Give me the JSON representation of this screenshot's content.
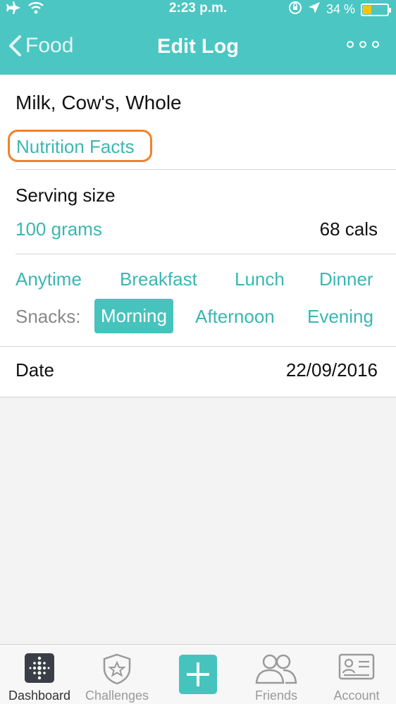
{
  "status_bar": {
    "time": "2:23 p.m.",
    "battery_percent": "34 %",
    "battery_level": 0.34
  },
  "nav": {
    "back_label": "Food",
    "title": "Edit Log"
  },
  "food": {
    "name": "Milk, Cow's, Whole",
    "nutrition_link": "Nutrition Facts"
  },
  "serving": {
    "label": "Serving size",
    "amount": "100 grams",
    "calories": "68 cals"
  },
  "meals": {
    "options": [
      "Anytime",
      "Breakfast",
      "Lunch",
      "Dinner"
    ],
    "snacks_label": "Snacks:",
    "snack_options": [
      "Morning",
      "Afternoon",
      "Evening"
    ],
    "selected": "Morning"
  },
  "date": {
    "label": "Date",
    "value": "22/09/2016"
  },
  "tabbar": {
    "items": [
      "Dashboard",
      "Challenges",
      "",
      "Friends",
      "Account"
    ],
    "active": "Dashboard"
  },
  "colors": {
    "accent": "#4cc6c2",
    "link": "#3ab7b2",
    "highlight_outline": "#f0822c",
    "battery": "#f5c50e"
  },
  "icons": {
    "status_left": [
      "airplane-icon",
      "wifi-icon"
    ],
    "status_right": [
      "rotation-lock-icon",
      "location-arrow-icon",
      "battery-icon"
    ],
    "nav": [
      "chevron-left-icon",
      "more-icon"
    ],
    "tabs": [
      "dashboard-icon",
      "challenges-star-icon",
      "plus-icon",
      "friends-icon",
      "account-card-icon"
    ]
  }
}
